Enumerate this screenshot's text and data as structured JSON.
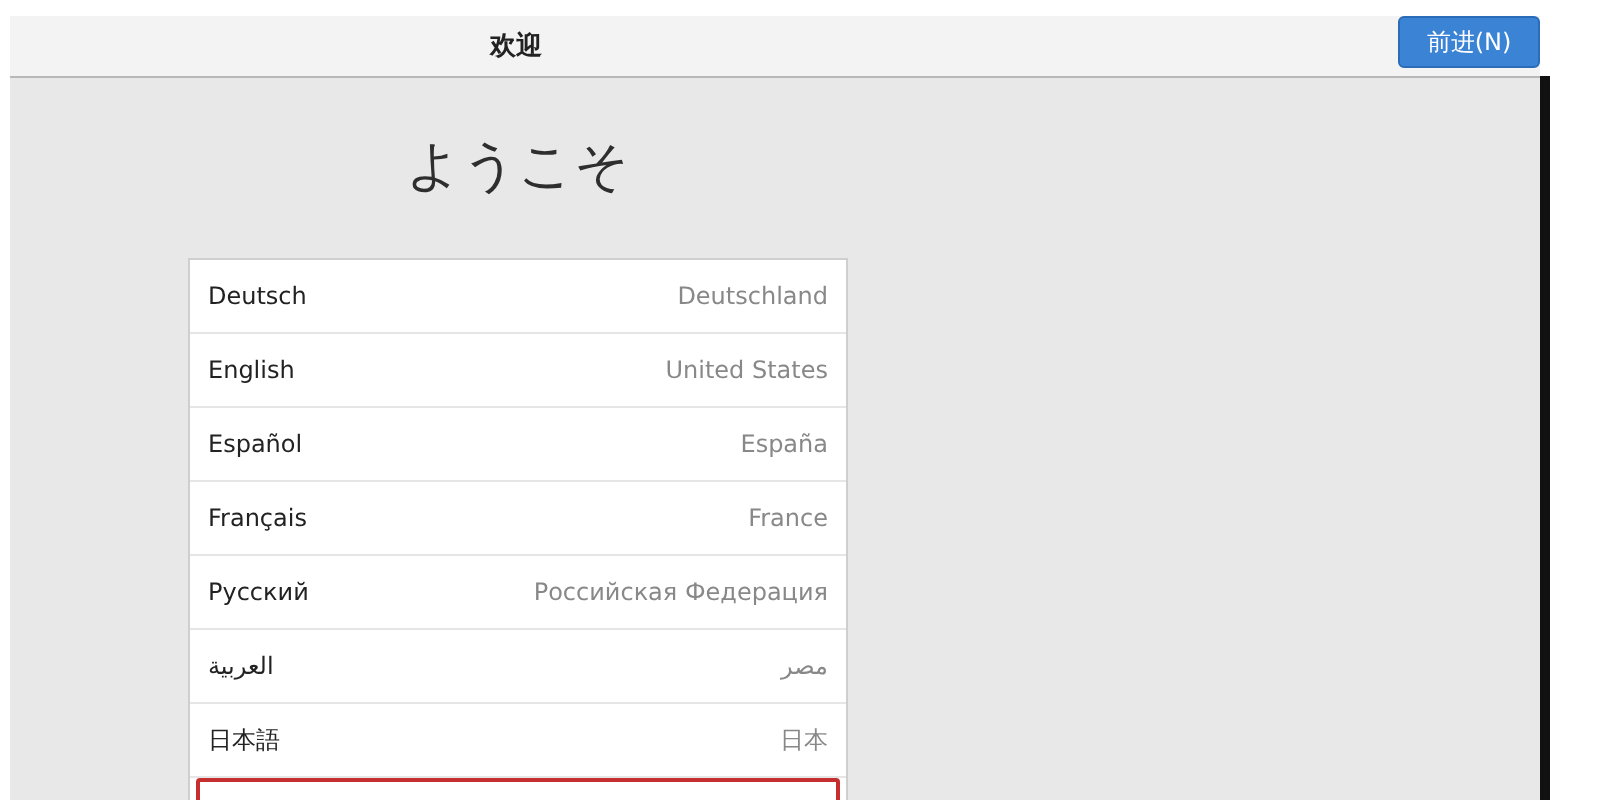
{
  "header": {
    "title": "欢迎",
    "next_button": "前进(N)"
  },
  "heading": "ようこそ",
  "languages": [
    {
      "language": "Deutsch",
      "region": "Deutschland",
      "selected": false
    },
    {
      "language": "English",
      "region": "United States",
      "selected": false
    },
    {
      "language": "Español",
      "region": "España",
      "selected": false
    },
    {
      "language": "Français",
      "region": "France",
      "selected": false
    },
    {
      "language": "Русский",
      "region": "Российская Федерация",
      "selected": false
    },
    {
      "language": "العربية",
      "region": "مصر",
      "selected": false
    },
    {
      "language": "日本語",
      "region": "日本",
      "selected": false
    },
    {
      "selected": true
    }
  ]
}
